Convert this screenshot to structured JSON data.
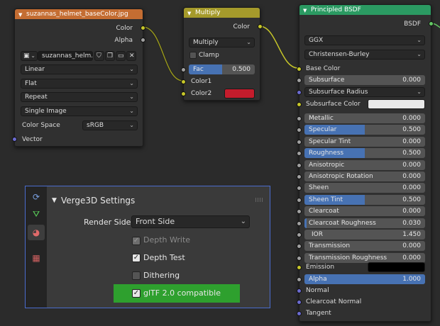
{
  "image_node": {
    "title": "suzannas_helmet_baseColor.jpg",
    "outputs": [
      "Color",
      "Alpha"
    ],
    "image_name": "suzannas_helm...",
    "interpolation": "Linear",
    "projection": "Flat",
    "extension": "Repeat",
    "source": "Single Image",
    "color_space_label": "Color Space",
    "color_space": "sRGB",
    "input": "Vector",
    "header_color": "#c46d32"
  },
  "multiply_node": {
    "title": "Multiply",
    "output": "Color",
    "blend_mode": "Multiply",
    "clamp_label": "Clamp",
    "fac_label": "Fac",
    "fac_value": "0.500",
    "fac_fraction": 0.5,
    "color1_label": "Color1",
    "color2_label": "Color2",
    "color2_swatch": "#c41c2c",
    "header_color": "#a59a2b"
  },
  "bsdf_node": {
    "title": "Principled BSDF",
    "output": "BSDF",
    "distribution": "GGX",
    "subsurface_method": "Christensen-Burley",
    "base_color_label": "Base Color",
    "subsurface": {
      "label": "Subsurface",
      "value": "0.000"
    },
    "subsurface_radius": "Subsurface Radius",
    "subsurface_color_label": "Subsurface Color",
    "subsurface_color_swatch": "#e8e8e8",
    "fields": [
      {
        "label": "Metallic",
        "value": "0.000",
        "fill": 0.0
      },
      {
        "label": "Specular",
        "value": "0.500",
        "fill": 0.5
      },
      {
        "label": "Specular Tint",
        "value": "0.000",
        "fill": 0.0
      },
      {
        "label": "Roughness",
        "value": "0.500",
        "fill": 0.5
      },
      {
        "label": "Anisotropic",
        "value": "0.000",
        "fill": 0.0
      },
      {
        "label": "Anisotropic Rotation",
        "value": "0.000",
        "fill": 0.0
      },
      {
        "label": "Sheen",
        "value": "0.000",
        "fill": 0.0
      },
      {
        "label": "Sheen Tint",
        "value": "0.500",
        "fill": 0.5
      },
      {
        "label": "Clearcoat",
        "value": "0.000",
        "fill": 0.0
      },
      {
        "label": "Clearcoat Roughness",
        "value": "0.030",
        "fill": 0.03
      },
      {
        "label": "IOR",
        "value": "1.450",
        "fill": 0.0
      },
      {
        "label": "Transmission",
        "value": "0.000",
        "fill": 0.0
      },
      {
        "label": "Transmission Roughness",
        "value": "0.000",
        "fill": 0.0
      }
    ],
    "emission_label": "Emission",
    "emission_swatch": "#000000",
    "alpha": {
      "label": "Alpha",
      "value": "1.000",
      "fill": 1.0
    },
    "vector_inputs": [
      "Normal",
      "Clearcoat Normal",
      "Tangent"
    ],
    "header_color": "#2b9a62"
  },
  "verge_panel": {
    "title": "Verge3D Settings",
    "render_side_label": "Render Side",
    "render_side_value": "Front Side",
    "depth_write": "Depth Write",
    "depth_test": "Depth Test",
    "dithering": "Dithering",
    "gltf_compat": "glTF 2.0 compatible",
    "gltf_color": "#2ea02e",
    "tabs": [
      "object-data-icon",
      "node-tree-icon",
      "material-icon",
      "texture-icon"
    ]
  }
}
